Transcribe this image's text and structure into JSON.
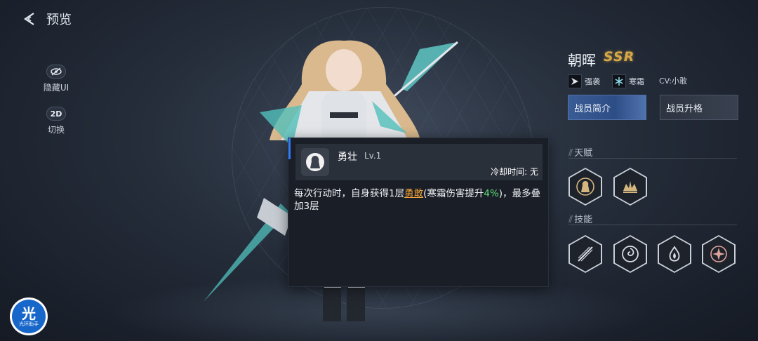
{
  "header": {
    "title": "预览"
  },
  "side_tools": [
    {
      "icon": "eye-off-icon",
      "label": "隐藏UI"
    },
    {
      "icon_text": "2D",
      "label": "切换"
    }
  ],
  "character": {
    "name": "朝晖",
    "rarity": "SSR",
    "tags": [
      {
        "icon": "assault-icon",
        "label": "强袭"
      },
      {
        "icon": "frost-icon",
        "label": "寒霜"
      }
    ],
    "cv": "CV:小敢"
  },
  "buttons": {
    "intro": "战员简介",
    "upgrade": "战员升格"
  },
  "sections": {
    "talent": "天赋",
    "skills": "技能"
  },
  "popup": {
    "skill_name": "勇壮",
    "level": "Lv.1",
    "cooldown": "冷却时间: 无",
    "desc": {
      "part1": "每次行动时，自身获得1层",
      "keyword": "勇敢",
      "part2": "(寒霜伤害提升",
      "percent": "4%",
      "part3": ")，最多叠加3层"
    }
  },
  "helper": {
    "big": "光",
    "small": "光环助手"
  },
  "colors": {
    "accent_blue": "#2f7cf6",
    "keyword_orange": "#f3a33b",
    "keyword_green": "#5ee07a",
    "rarity_gold": "#d9a847"
  }
}
